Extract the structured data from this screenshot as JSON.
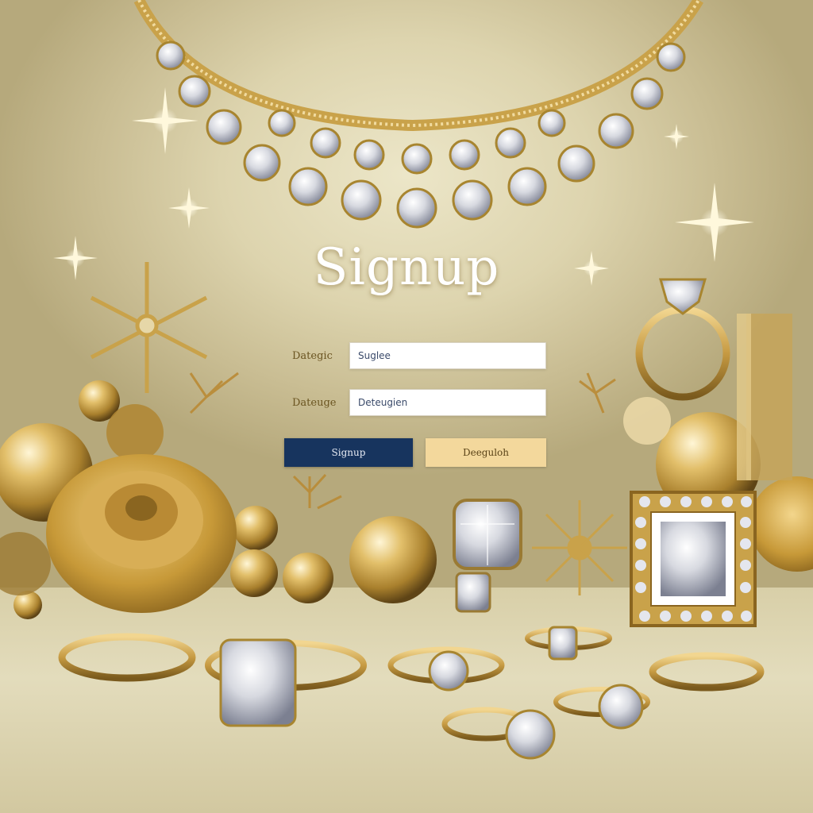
{
  "form": {
    "title": "Signup",
    "field1": {
      "label": "Dategic",
      "value": "Suglee"
    },
    "field2": {
      "label": "Dateuge",
      "value": "Deteugien"
    },
    "primary_button_label": "Signup",
    "secondary_button_label": "Deeguloh"
  },
  "colors": {
    "primary_button": "#17345e",
    "secondary_button": "#f3d89c",
    "gold_accent": "#c9a24a"
  },
  "decor": {
    "background_theme": "gold-jewelry",
    "icons": [
      "necklace-icon",
      "sparkle-icon",
      "rose-icon",
      "ring-icon",
      "gem-icon",
      "pearl-icon",
      "snowflake-brooch-icon"
    ]
  }
}
